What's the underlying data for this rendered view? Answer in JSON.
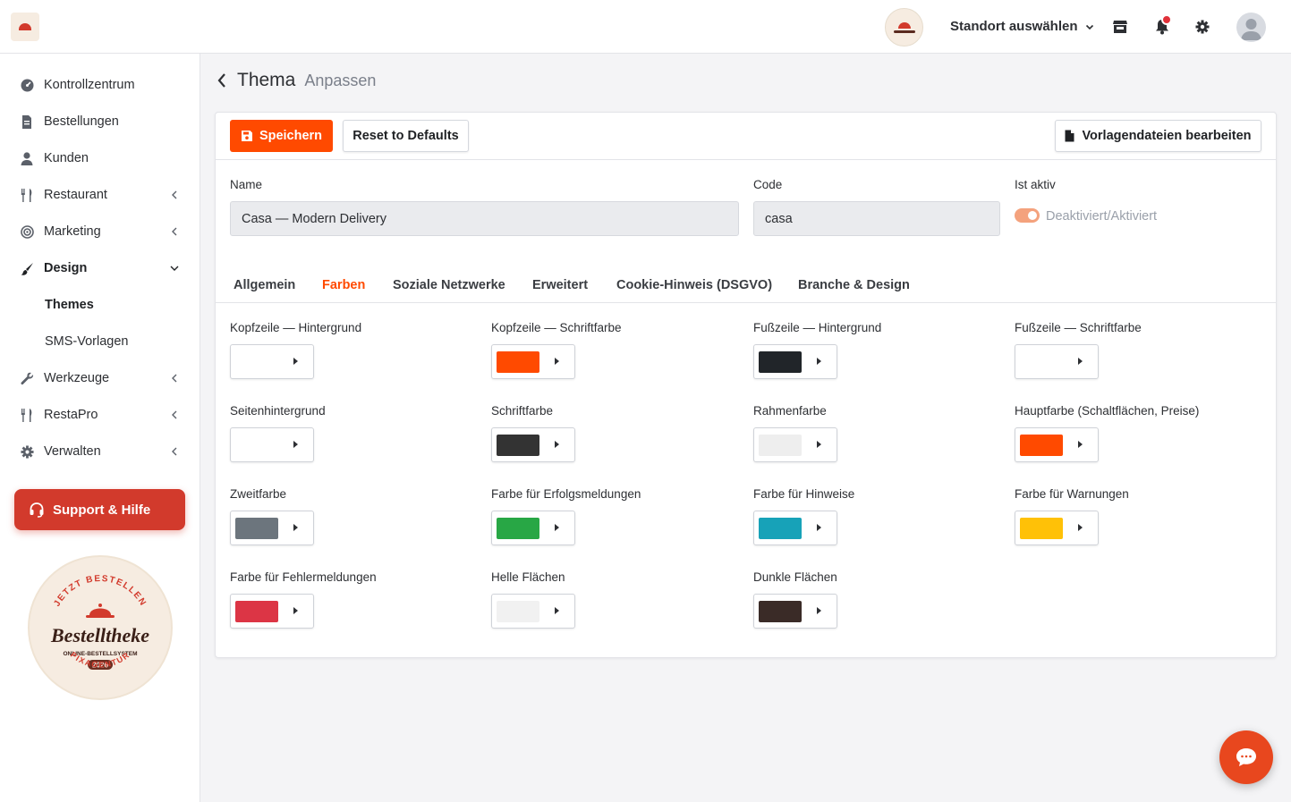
{
  "topbar": {
    "location_label": "Standort auswählen",
    "icons": [
      "store-icon",
      "bell-icon",
      "gear-icon",
      "user-avatar"
    ]
  },
  "sidebar": {
    "items": [
      {
        "label": "Kontrollzentrum",
        "icon": "dashboard-icon"
      },
      {
        "label": "Bestellungen",
        "icon": "receipt-icon"
      },
      {
        "label": "Kunden",
        "icon": "user-icon"
      },
      {
        "label": "Restaurant",
        "icon": "utensils-icon"
      },
      {
        "label": "Marketing",
        "icon": "bullseye-icon"
      },
      {
        "label": "Design",
        "icon": "brush-icon"
      },
      {
        "label": "Themes",
        "icon": ""
      },
      {
        "label": "SMS-Vorlagen",
        "icon": ""
      },
      {
        "label": "Werkzeuge",
        "icon": "wrench-icon"
      },
      {
        "label": "RestaPro",
        "icon": "utensils-icon"
      },
      {
        "label": "Verwalten",
        "icon": "gear-icon"
      }
    ],
    "support_label": "Support & Hilfe"
  },
  "page": {
    "title": "Thema",
    "subtitle": "Anpassen"
  },
  "toolbar": {
    "save_label": "Speichern",
    "reset_label": "Reset to Defaults",
    "templates_label": "Vorlagendateien bearbeiten"
  },
  "form": {
    "name_label": "Name",
    "name_value": "Casa — Modern Delivery",
    "code_label": "Code",
    "code_value": "casa",
    "active_label": "Ist aktiv",
    "active_toggle_label": "Deaktiviert/Aktiviert",
    "active": true
  },
  "tabs": [
    {
      "label": "Allgemein",
      "active": false
    },
    {
      "label": "Farben",
      "active": true
    },
    {
      "label": "Soziale Netzwerke",
      "active": false
    },
    {
      "label": "Erweitert",
      "active": false
    },
    {
      "label": "Cookie-Hinweis (DSGVO)",
      "active": false
    },
    {
      "label": "Branche & Design",
      "active": false
    }
  ],
  "colors": [
    {
      "label": "Kopfzeile — Hintergrund",
      "value": "#ffffff"
    },
    {
      "label": "Kopfzeile — Schriftfarbe",
      "value": "#ff4a00"
    },
    {
      "label": "Fußzeile — Hintergrund",
      "value": "#212529"
    },
    {
      "label": "Fußzeile — Schriftfarbe",
      "value": "#ffffff"
    },
    {
      "label": "Seitenhintergrund",
      "value": "#ffffff"
    },
    {
      "label": "Schriftfarbe",
      "value": "#333333"
    },
    {
      "label": "Rahmenfarbe",
      "value": "#eeeeee"
    },
    {
      "label": "Hauptfarbe (Schaltflächen, Preise)",
      "value": "#ff4a00"
    },
    {
      "label": "Zweitfarbe",
      "value": "#6c757d"
    },
    {
      "label": "Farbe für Erfolgsmeldungen",
      "value": "#28a745"
    },
    {
      "label": "Farbe für Hinweise",
      "value": "#17a2b8"
    },
    {
      "label": "Farbe für Warnungen",
      "value": "#ffc107"
    },
    {
      "label": "Farbe für Fehlermeldungen",
      "value": "#dc3545"
    },
    {
      "label": "Helle Flächen",
      "value": "#f1f1f1"
    },
    {
      "label": "Dunkle Flächen",
      "value": "#3a2b27"
    }
  ],
  "brand": {
    "accent": "#ff4a00",
    "support_red": "#d23a2c",
    "badge_top_text": "JETZT BESTELLEN",
    "badge_name": "Bestelltheke",
    "badge_sub": "ONLINE-BESTELLSYSTEM",
    "badge_year": "2026",
    "badge_bottom_text": "PIXAGENTUR"
  }
}
